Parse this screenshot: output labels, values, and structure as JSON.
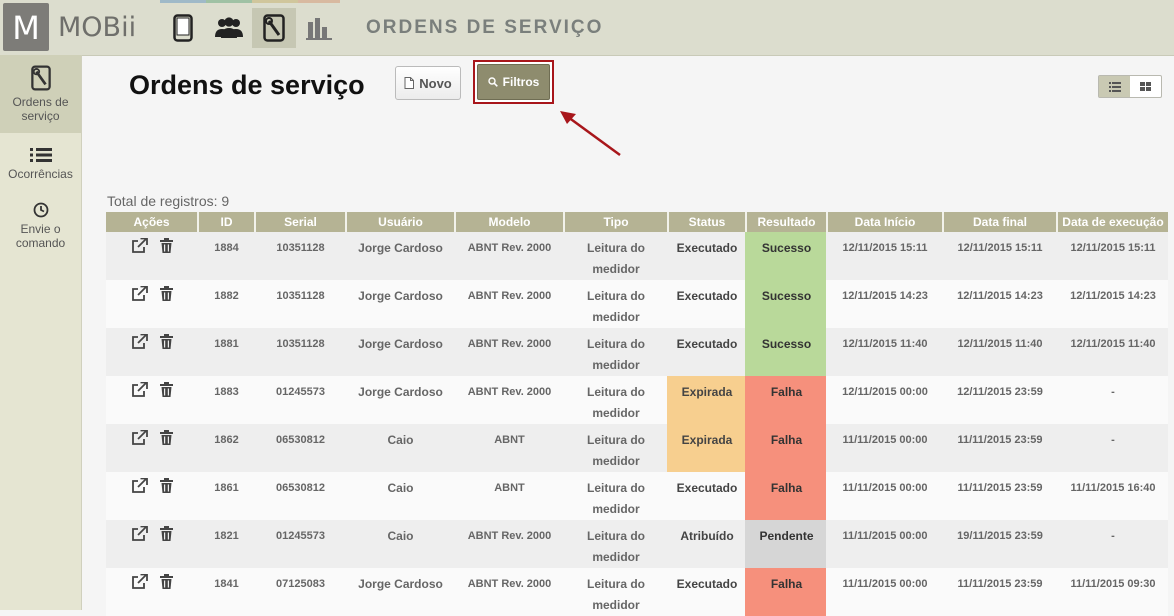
{
  "app": {
    "logo_letter": "M",
    "logo_text": "MOBii",
    "section_title": "ORDENS DE SERVIÇO",
    "nav_strip_colors": [
      "#9fb9c8",
      "#9fc1a4",
      "#d0c69c",
      "#d8b9a0"
    ]
  },
  "top_nav": [
    {
      "name": "tablet-icon",
      "active": false
    },
    {
      "name": "users-icon",
      "active": false
    },
    {
      "name": "service-order-icon",
      "active": true
    },
    {
      "name": "bar-chart-icon",
      "active": false
    }
  ],
  "sidebar": {
    "items": [
      {
        "label_line1": "Ordens de",
        "label_line2": "serviço",
        "icon": "service-order-icon",
        "active": true
      },
      {
        "label_line1": "Ocorrências",
        "label_line2": "",
        "icon": "list-icon",
        "active": false
      },
      {
        "label_line1": "Envie o",
        "label_line2": "comando",
        "icon": "clock-icon",
        "active": false
      }
    ]
  },
  "page": {
    "title": "Ordens de serviço",
    "new_button": "Novo",
    "filters_button": "Filtros",
    "total_label": "Total de registros: 9"
  },
  "colors": {
    "header": "#b5b394",
    "success": "#b9d99a",
    "failure": "#f6907c",
    "expired": "#f7cf8f",
    "pending": "#d6d6d6",
    "highlight_frame": "#a8161b"
  },
  "table": {
    "columns": [
      "Ações",
      "ID",
      "Serial",
      "Usuário",
      "Modelo",
      "Tipo",
      "Status",
      "Resultado",
      "Data Início",
      "Data final",
      "Data de execução"
    ],
    "rows": [
      {
        "id": "1884",
        "serial": "10351128",
        "user": "Jorge Cardoso",
        "model": "ABNT Rev. 2000",
        "type1": "Leitura do",
        "type2": "medidor",
        "status": "Executado",
        "result": "Sucesso",
        "start": "12/11/2015 15:11",
        "end": "12/11/2015 15:11",
        "exec": "12/11/2015 15:11"
      },
      {
        "id": "1882",
        "serial": "10351128",
        "user": "Jorge Cardoso",
        "model": "ABNT Rev. 2000",
        "type1": "Leitura do",
        "type2": "medidor",
        "status": "Executado",
        "result": "Sucesso",
        "start": "12/11/2015 14:23",
        "end": "12/11/2015 14:23",
        "exec": "12/11/2015 14:23"
      },
      {
        "id": "1881",
        "serial": "10351128",
        "user": "Jorge Cardoso",
        "model": "ABNT Rev. 2000",
        "type1": "Leitura do",
        "type2": "medidor",
        "status": "Executado",
        "result": "Sucesso",
        "start": "12/11/2015 11:40",
        "end": "12/11/2015 11:40",
        "exec": "12/11/2015 11:40"
      },
      {
        "id": "1883",
        "serial": "01245573",
        "user": "Jorge Cardoso",
        "model": "ABNT Rev. 2000",
        "type1": "Leitura do",
        "type2": "medidor",
        "status": "Expirada",
        "result": "Falha",
        "start": "12/11/2015 00:00",
        "end": "12/11/2015 23:59",
        "exec": "-"
      },
      {
        "id": "1862",
        "serial": "06530812",
        "user": "Caio",
        "model": "ABNT",
        "type1": "Leitura do",
        "type2": "medidor",
        "status": "Expirada",
        "result": "Falha",
        "start": "11/11/2015 00:00",
        "end": "11/11/2015 23:59",
        "exec": "-"
      },
      {
        "id": "1861",
        "serial": "06530812",
        "user": "Caio",
        "model": "ABNT",
        "type1": "Leitura do",
        "type2": "medidor",
        "status": "Executado",
        "result": "Falha",
        "start": "11/11/2015 00:00",
        "end": "11/11/2015 23:59",
        "exec": "11/11/2015 16:40"
      },
      {
        "id": "1821",
        "serial": "01245573",
        "user": "Caio",
        "model": "ABNT Rev. 2000",
        "type1": "Leitura do",
        "type2": "medidor",
        "status": "Atribuído",
        "result": "Pendente",
        "start": "11/11/2015 00:00",
        "end": "19/11/2015 23:59",
        "exec": "-"
      },
      {
        "id": "1841",
        "serial": "07125083",
        "user": "Jorge Cardoso",
        "model": "ABNT Rev. 2000",
        "type1": "Leitura do",
        "type2": "medidor",
        "status": "Executado",
        "result": "Falha",
        "start": "11/11/2015 00:00",
        "end": "11/11/2015 23:59",
        "exec": "11/11/2015 09:30"
      }
    ]
  }
}
